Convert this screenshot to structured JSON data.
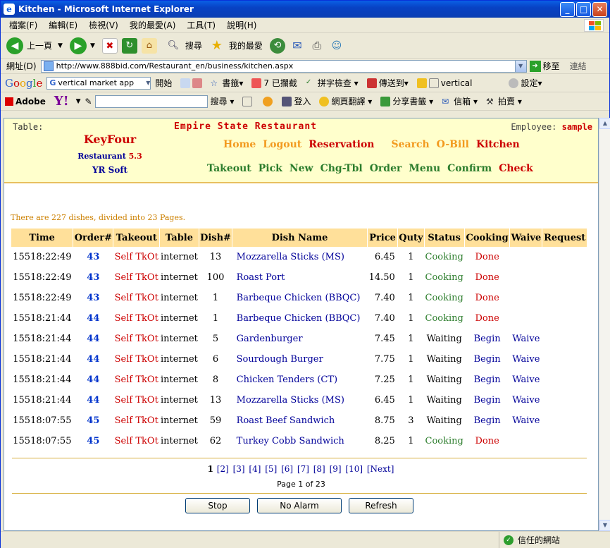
{
  "window": {
    "title": "Kitchen - Microsoft Internet Explorer"
  },
  "menu": [
    "檔案(F)",
    "編輯(E)",
    "檢視(V)",
    "我的最愛(A)",
    "工具(T)",
    "說明(H)"
  ],
  "toolbar": {
    "back": "上一頁",
    "search": "搜尋",
    "favorites": "我的最愛"
  },
  "address": {
    "label": "網址(D)",
    "url": "http://www.888bid.com/Restaurant_en/business/kitchen.aspx",
    "go": "移至",
    "links": "連結"
  },
  "google_bar": {
    "search_value": "vertical market app",
    "open": "開始",
    "bookmarks": "書籤▾",
    "blocked": "7 已攔截",
    "spell": "拼字檢查 ▾",
    "send": "傳送到▾",
    "term": "vertical",
    "settings": "設定▾"
  },
  "yahoo_bar": {
    "adobe": "Adobe",
    "search": "搜尋 ▾",
    "login": "登入",
    "translate": "網頁翻譯 ▾",
    "share": "分享書籤 ▾",
    "mail": "信箱 ▾",
    "auction": "拍賣 ▾"
  },
  "header": {
    "table_label": "Table:",
    "restaurant": "Empire State Restaurant",
    "employee_label": "Employee:",
    "employee": "sample",
    "brand": "KeyFour",
    "product": "Restaurant",
    "version": "5.3",
    "company": "YR Soft",
    "nav_top": [
      {
        "label": "Home",
        "color": "orange"
      },
      {
        "label": "Logout",
        "color": "orange"
      },
      {
        "label": "Reservation",
        "color": "red"
      },
      {
        "label": "Search",
        "color": "orange"
      },
      {
        "label": "O-Bill",
        "color": "orange"
      },
      {
        "label": "Kitchen",
        "color": "red"
      }
    ],
    "nav_bottom": [
      {
        "label": "Takeout",
        "color": "green"
      },
      {
        "label": "Pick",
        "color": "green"
      },
      {
        "label": "New",
        "color": "green"
      },
      {
        "label": "Chg-Tbl",
        "color": "green"
      },
      {
        "label": "Order",
        "color": "green"
      },
      {
        "label": "Menu",
        "color": "green"
      },
      {
        "label": "Confirm",
        "color": "green"
      },
      {
        "label": "Check",
        "color": "red"
      }
    ]
  },
  "summary": "There are 227 dishes, divided into 23 Pages.",
  "table": {
    "columns": [
      "Time",
      "Order#",
      "Takeout",
      "Table",
      "Dish#",
      "Dish Name",
      "Price",
      "Quty",
      "Status",
      "Cooking",
      "Waive",
      "Request"
    ],
    "rows": [
      [
        "15518:22:49",
        "43",
        "Self TkOt",
        "internet",
        "13",
        "Mozzarella Sticks (MS)",
        "6.45",
        "1",
        "Cooking",
        "Done",
        "",
        ""
      ],
      [
        "15518:22:49",
        "43",
        "Self TkOt",
        "internet",
        "100",
        "Roast Port",
        "14.50",
        "1",
        "Cooking",
        "Done",
        "",
        ""
      ],
      [
        "15518:22:49",
        "43",
        "Self TkOt",
        "internet",
        "1",
        "Barbeque Chicken (BBQC)",
        "7.40",
        "1",
        "Cooking",
        "Done",
        "",
        ""
      ],
      [
        "15518:21:44",
        "44",
        "Self TkOt",
        "internet",
        "1",
        "Barbeque Chicken (BBQC)",
        "7.40",
        "1",
        "Cooking",
        "Done",
        "",
        ""
      ],
      [
        "15518:21:44",
        "44",
        "Self TkOt",
        "internet",
        "5",
        "Gardenburger",
        "7.45",
        "1",
        "Waiting",
        "Begin",
        "Waive",
        ""
      ],
      [
        "15518:21:44",
        "44",
        "Self TkOt",
        "internet",
        "6",
        "Sourdough Burger",
        "7.75",
        "1",
        "Waiting",
        "Begin",
        "Waive",
        ""
      ],
      [
        "15518:21:44",
        "44",
        "Self TkOt",
        "internet",
        "8",
        "Chicken Tenders (CT)",
        "7.25",
        "1",
        "Waiting",
        "Begin",
        "Waive",
        ""
      ],
      [
        "15518:21:44",
        "44",
        "Self TkOt",
        "internet",
        "13",
        "Mozzarella Sticks (MS)",
        "6.45",
        "1",
        "Waiting",
        "Begin",
        "Waive",
        ""
      ],
      [
        "15518:07:55",
        "45",
        "Self TkOt",
        "internet",
        "59",
        "Roast Beef Sandwich",
        "8.75",
        "3",
        "Waiting",
        "Begin",
        "Waive",
        ""
      ],
      [
        "15518:07:55",
        "45",
        "Self TkOt",
        "internet",
        "62",
        "Turkey Cobb Sandwich",
        "8.25",
        "1",
        "Cooking",
        "Done",
        "",
        ""
      ]
    ]
  },
  "pager": {
    "current": "1",
    "pages": [
      "[2]",
      "[3]",
      "[4]",
      "[5]",
      "[6]",
      "[7]",
      "[8]",
      "[9]",
      "[10]",
      "[Next]"
    ],
    "page_of": "Page 1 of 23"
  },
  "buttons": {
    "stop": "Stop",
    "no_alarm": "No Alarm",
    "refresh": "Refresh"
  },
  "status": {
    "zone": "信任的網站"
  },
  "colors": {
    "accent_red": "#cc0000",
    "accent_orange": "#f29a1e",
    "accent_green": "#2c7d2c",
    "header_bg": "#ffffcc",
    "table_header_bg": "#ffe09a"
  }
}
